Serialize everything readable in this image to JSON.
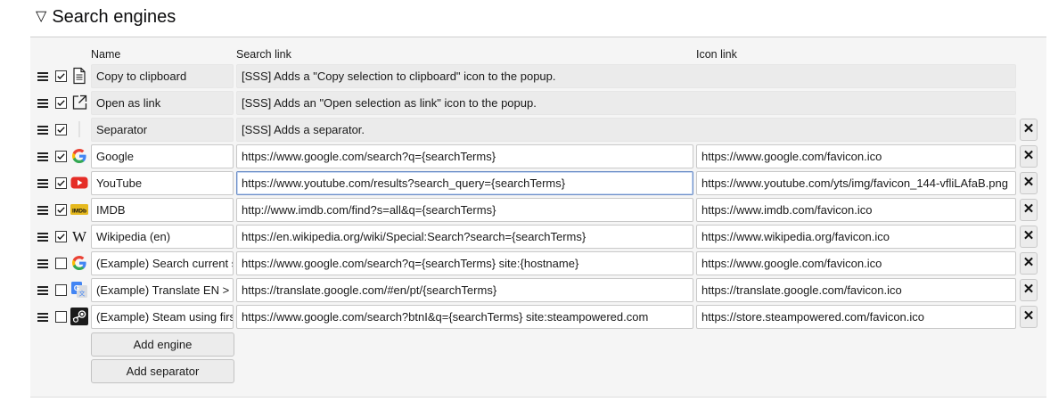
{
  "section": {
    "title": "Search engines",
    "toggle_glyph": "▽"
  },
  "columns": {
    "name": "Name",
    "search_link": "Search link",
    "icon_link": "Icon link"
  },
  "delete_glyph": "✕",
  "engines": [
    {
      "checked": true,
      "icon": "document-copy-icon",
      "name": "Copy to clipboard",
      "search_link": "[SSS] Adds a \"Copy selection to clipboard\" icon to the popup.",
      "icon_link": "",
      "builtin": true,
      "deletable": false
    },
    {
      "checked": true,
      "icon": "open-link-icon",
      "name": "Open as link",
      "search_link": "[SSS] Adds an \"Open selection as link\" icon to the popup.",
      "icon_link": "",
      "builtin": true,
      "deletable": false
    },
    {
      "checked": true,
      "icon": "separator-icon",
      "name": "Separator",
      "search_link": "[SSS] Adds a separator.",
      "icon_link": "",
      "builtin": true,
      "deletable": true
    },
    {
      "checked": true,
      "icon": "google-icon",
      "name": "Google",
      "search_link": "https://www.google.com/search?q={searchTerms}",
      "icon_link": "https://www.google.com/favicon.ico",
      "builtin": false,
      "deletable": true
    },
    {
      "checked": true,
      "icon": "youtube-icon",
      "name": "YouTube",
      "search_link": "https://www.youtube.com/results?search_query={searchTerms}",
      "icon_link": "https://www.youtube.com/yts/img/favicon_144-vfliLAfaB.png",
      "builtin": false,
      "deletable": true,
      "focused": true
    },
    {
      "checked": true,
      "icon": "imdb-icon",
      "name": "IMDB",
      "search_link": "http://www.imdb.com/find?s=all&q={searchTerms}",
      "icon_link": "https://www.imdb.com/favicon.ico",
      "builtin": false,
      "deletable": true
    },
    {
      "checked": true,
      "icon": "wikipedia-icon",
      "name": "Wikipedia (en)",
      "search_link": "https://en.wikipedia.org/wiki/Special:Search?search={searchTerms}",
      "icon_link": "https://www.wikipedia.org/favicon.ico",
      "builtin": false,
      "deletable": true
    },
    {
      "checked": false,
      "icon": "google-icon",
      "name": "(Example) Search current site",
      "search_link": "https://www.google.com/search?q={searchTerms} site:{hostname}",
      "icon_link": "https://www.google.com/favicon.ico",
      "builtin": false,
      "deletable": true
    },
    {
      "checked": false,
      "icon": "google-translate-icon",
      "name": "(Example) Translate EN > PT",
      "search_link": "https://translate.google.com/#en/pt/{searchTerms}",
      "icon_link": "https://translate.google.com/favicon.ico",
      "builtin": false,
      "deletable": true
    },
    {
      "checked": false,
      "icon": "steam-icon",
      "name": "(Example) Steam using first result",
      "search_link": "https://www.google.com/search?btnI&q={searchTerms} site:steampowered.com",
      "icon_link": "https://store.steampowered.com/favicon.ico",
      "builtin": false,
      "deletable": true
    }
  ],
  "buttons": {
    "add_engine": "Add engine",
    "add_separator": "Add separator"
  }
}
